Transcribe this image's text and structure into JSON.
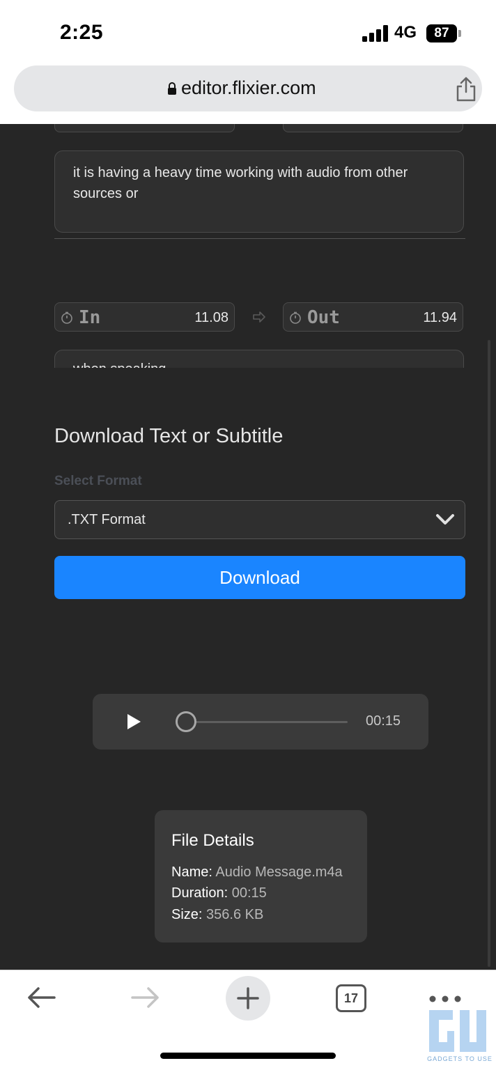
{
  "status_bar": {
    "time": "2:25",
    "network": "4G",
    "battery": "87"
  },
  "browser": {
    "url": "editor.flixier.com",
    "tab_count": "17"
  },
  "transcript": {
    "segments": [
      {
        "text": "it is having a heavy time working with audio from other sources or"
      },
      {
        "in_label": "In",
        "in_value": "11.08",
        "out_label": "Out",
        "out_value": "11.94",
        "text": "when speaking"
      }
    ]
  },
  "download": {
    "title": "Download Text or Subtitle",
    "select_label": "Select Format",
    "selected_format": ".TXT Format",
    "button_label": "Download"
  },
  "player": {
    "time": "00:15",
    "progress": 0
  },
  "file_details": {
    "title": "File Details",
    "name_label": "Name:",
    "name_value": "Audio Message.m4a",
    "duration_label": "Duration:",
    "duration_value": "00:15",
    "size_label": "Size:",
    "size_value": "356.6 KB"
  },
  "watermark": {
    "text": "GADGETS TO USE"
  }
}
